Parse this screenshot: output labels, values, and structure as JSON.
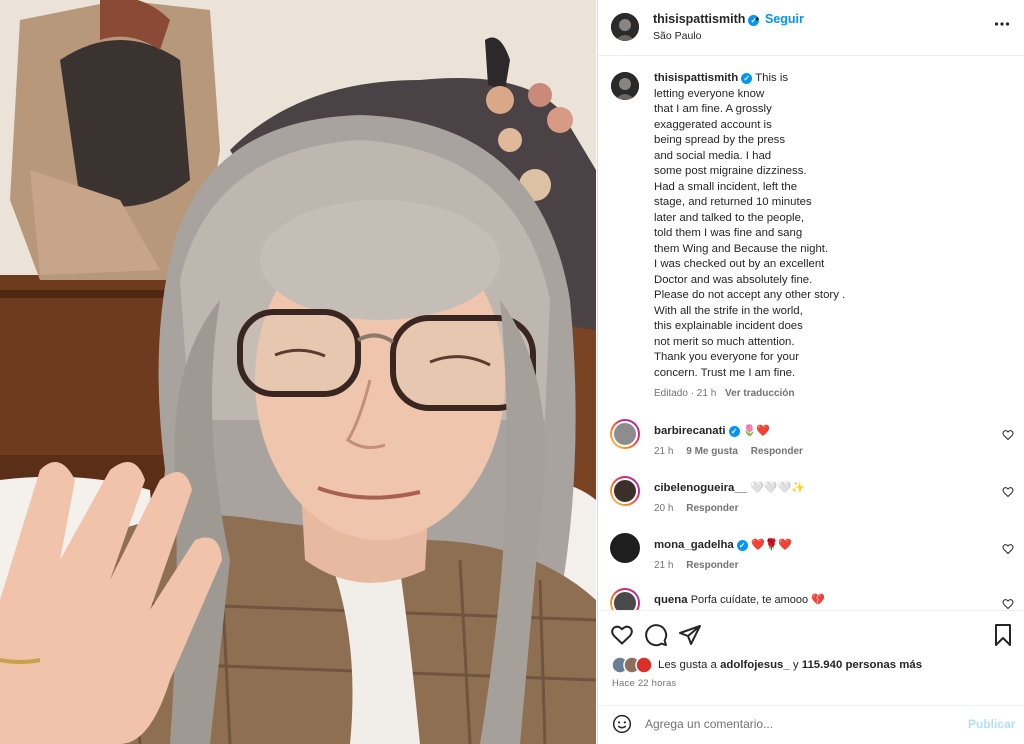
{
  "post": {
    "username": "thisispattismith",
    "verified_mark": "✓",
    "dot": "•",
    "follow_label": "Seguir",
    "location": "São Paulo",
    "more_icon": "more-horizontal-icon"
  },
  "caption": {
    "username": "thisispattismith",
    "lines": [
      "This is",
      "letting everyone know",
      "that I am fine. A grossly",
      "exaggerated account is",
      "being spread by the press",
      "and social media. I had",
      "some post migraine dizziness.",
      "Had a small incident, left the",
      "stage, and returned 10 minutes",
      "later and talked to the people,",
      "told them I was fine and sang",
      "them Wing and Because the night.",
      "I was checked out by an excellent",
      "Doctor and was absolutely fine.",
      "Please do not accept any other story .",
      "With all the strife in the world,",
      "this explainable incident does",
      "not merit so much attention.",
      "Thank you everyone for your",
      "concern. Trust me I am fine."
    ],
    "edited": "Editado · 21 h",
    "see_translation": "Ver traducción"
  },
  "comments": [
    {
      "username": "barbirecanati",
      "verified": true,
      "text": "🌷❤️",
      "time": "21 h",
      "likes": "9 Me gusta",
      "reply": "Responder"
    },
    {
      "username": "cibelenogueira__",
      "verified": false,
      "text": "🤍🤍🤍✨",
      "time": "20 h",
      "likes": "",
      "reply": "Responder"
    },
    {
      "username": "mona_gadelha",
      "verified": true,
      "text": "❤️🌹❤️",
      "time": "21 h",
      "likes": "",
      "reply": "Responder"
    },
    {
      "username": "quena",
      "verified": false,
      "text": "Porfa cuídate, te amooo 💔",
      "time": "",
      "likes": "",
      "reply": ""
    }
  ],
  "likes": {
    "prefix": "Les gusta a ",
    "first_user": "adolfojesus_",
    "middle": " y ",
    "count": "115.940 personas más"
  },
  "post_time": "Hace 22 horas",
  "comment_input": {
    "placeholder": "Agrega un comentario...",
    "value": ""
  },
  "publish_label": "Publicar",
  "icons": [
    "heart-icon",
    "comment-icon",
    "share-icon",
    "bookmark-icon",
    "emoji-icon"
  ],
  "colors": {
    "accent": "#0095f6",
    "publish_disabled": "#b2dffc",
    "secondary_text": "#737373"
  }
}
